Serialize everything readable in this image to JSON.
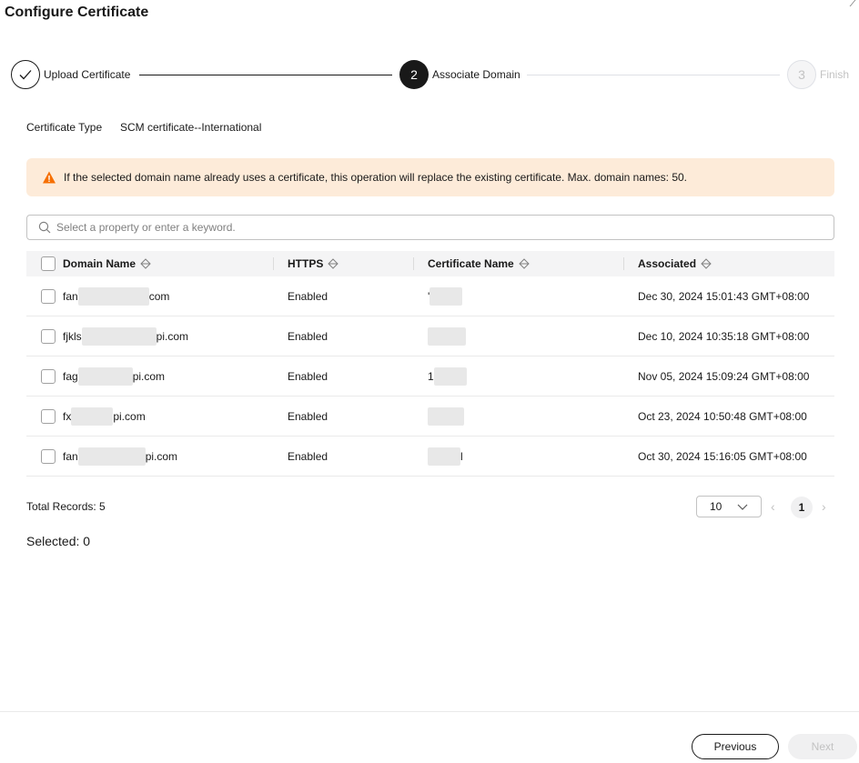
{
  "dialog": {
    "title": "Configure Certificate"
  },
  "stepper": {
    "steps": [
      {
        "number": "",
        "label": "Upload Certificate",
        "state": "done"
      },
      {
        "number": "2",
        "label": "Associate Domain",
        "state": "active"
      },
      {
        "number": "3",
        "label": "Finish",
        "state": "todo"
      }
    ]
  },
  "cert_type": {
    "label": "Certificate Type",
    "value": "SCM certificate--International"
  },
  "alert": {
    "text": "If the selected domain name already uses a certificate, this operation will replace the existing certificate. Max. domain names: 50.",
    "icon": "warning-icon"
  },
  "search": {
    "placeholder": "Select a property or enter a keyword."
  },
  "table": {
    "columns": [
      "Domain Name",
      "HTTPS",
      "Certificate Name",
      "Associated"
    ],
    "rows": [
      {
        "domain_prefix": "fan",
        "domain_suffix": "com",
        "https": "Enabled",
        "cert_prefix": "'",
        "cert_suffix": "",
        "associated": "Dec 30, 2024 15:01:43 GMT+08:00"
      },
      {
        "domain_prefix": "fjkls",
        "domain_suffix": "pi.com",
        "https": "Enabled",
        "cert_prefix": "",
        "cert_suffix": "",
        "associated": "Dec 10, 2024 10:35:18 GMT+08:00"
      },
      {
        "domain_prefix": "fag",
        "domain_suffix": "pi.com",
        "https": "Enabled",
        "cert_prefix": "1",
        "cert_suffix": "",
        "associated": "Nov 05, 2024 15:09:24 GMT+08:00"
      },
      {
        "domain_prefix": "fx",
        "domain_suffix": "pi.com",
        "https": "Enabled",
        "cert_prefix": "",
        "cert_suffix": "",
        "associated": "Oct 23, 2024 10:50:48 GMT+08:00"
      },
      {
        "domain_prefix": "fan",
        "domain_suffix": "pi.com",
        "https": "Enabled",
        "cert_prefix": "",
        "cert_suffix": "l",
        "associated": "Oct 30, 2024 15:16:05 GMT+08:00"
      }
    ]
  },
  "pagination": {
    "total_label": "Total Records: 5",
    "page_size": "10",
    "current_page": "1",
    "prev": "‹",
    "next": "›"
  },
  "selection": {
    "label": "Selected: 0"
  },
  "footer": {
    "previous_label": "Previous",
    "next_label": "Next"
  },
  "colors": {
    "primary": "#191919",
    "alert_bg": "#fdebd9",
    "warning": "#f66f00",
    "disabled": "#c2c2c2"
  }
}
